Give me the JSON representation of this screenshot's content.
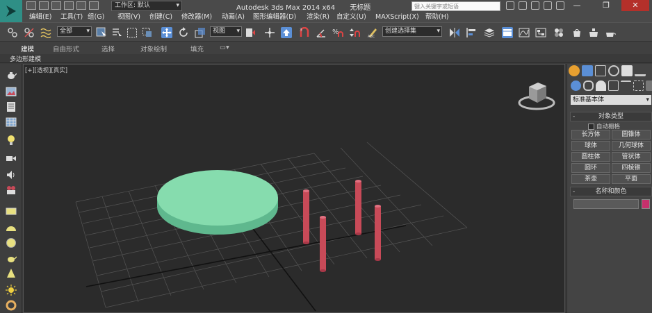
{
  "titlebar": {
    "workspace_label": "工作区: 默认",
    "app_title": "Autodesk 3ds Max  2014 x64",
    "doc_title": "无标题",
    "search_placeholder": "键入关键字或短语"
  },
  "menu": {
    "items": [
      "编辑(E)",
      "工具(T)",
      "组(G)",
      "视图(V)",
      "创建(C)",
      "修改器(M)",
      "动画(A)",
      "图形编辑器(D)",
      "渲染(R)",
      "自定义(U)",
      "MAXScript(X)",
      "帮助(H)"
    ]
  },
  "toolbar": {
    "selection_filter": "全部",
    "reference_coord": "视图",
    "named_selection": "创建选择集"
  },
  "ribbon": {
    "tabs": [
      "建模",
      "自由形式",
      "选择",
      "对象绘制",
      "填充"
    ],
    "sub_label": "多边形建模"
  },
  "viewport": {
    "label": "[+][透视][真实]"
  },
  "command_panel": {
    "category_dropdown": "标准基本体",
    "object_type_header": "对象类型",
    "autogrid_label": "自动栅格",
    "object_buttons": [
      "长方体",
      "圆锥体",
      "球体",
      "几何球体",
      "圆柱体",
      "管状体",
      "圆环",
      "四棱锥",
      "茶壶",
      "平面"
    ],
    "name_color_header": "名称和颜色"
  },
  "colors": {
    "disk": "#7fd6a8",
    "cylinders": "#c84a58",
    "object_color": "#c6306c"
  }
}
